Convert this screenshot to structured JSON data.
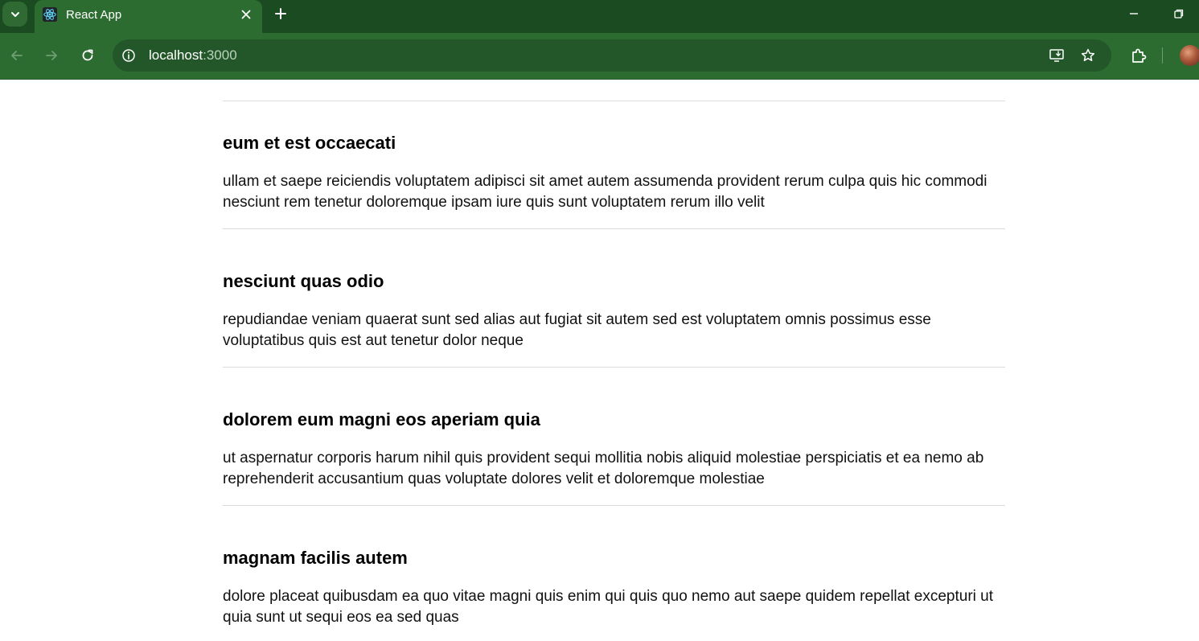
{
  "browser": {
    "tab": {
      "title": "React App",
      "favicon": "react-logo-icon"
    },
    "address_bar": {
      "host": "localhost",
      "port": ":3000"
    },
    "icons": {
      "tab_search": "chevron-down-icon",
      "close_tab": "close-icon",
      "new_tab": "plus-icon",
      "minimize": "minimize-icon",
      "restore": "restore-icon",
      "back": "arrow-left-icon",
      "forward": "arrow-right-icon",
      "reload": "reload-icon",
      "site_info": "info-icon",
      "install": "install-app-icon",
      "bookmark": "star-icon",
      "extensions": "puzzle-icon"
    },
    "colors": {
      "tabstrip": "#1b4b20",
      "toolbar": "#2c6c31",
      "omnibox": "#23572a"
    }
  },
  "posts": [
    {
      "title": "eum et est occaecati",
      "body": "ullam et saepe reiciendis voluptatem adipisci sit amet autem assumenda provident rerum culpa quis hic commodi nesciunt rem tenetur doloremque ipsam iure quis sunt voluptatem rerum illo velit"
    },
    {
      "title": "nesciunt quas odio",
      "body": "repudiandae veniam quaerat sunt sed alias aut fugiat sit autem sed est voluptatem omnis possimus esse voluptatibus quis est aut tenetur dolor neque"
    },
    {
      "title": "dolorem eum magni eos aperiam quia",
      "body": "ut aspernatur corporis harum nihil quis provident sequi mollitia nobis aliquid molestiae perspiciatis et ea nemo ab reprehenderit accusantium quas voluptate dolores velit et doloremque molestiae"
    },
    {
      "title": "magnam facilis autem",
      "body": "dolore placeat quibusdam ea quo vitae magni quis enim qui quis quo nemo aut saepe quidem repellat excepturi ut quia sunt ut sequi eos ea sed quas"
    }
  ]
}
